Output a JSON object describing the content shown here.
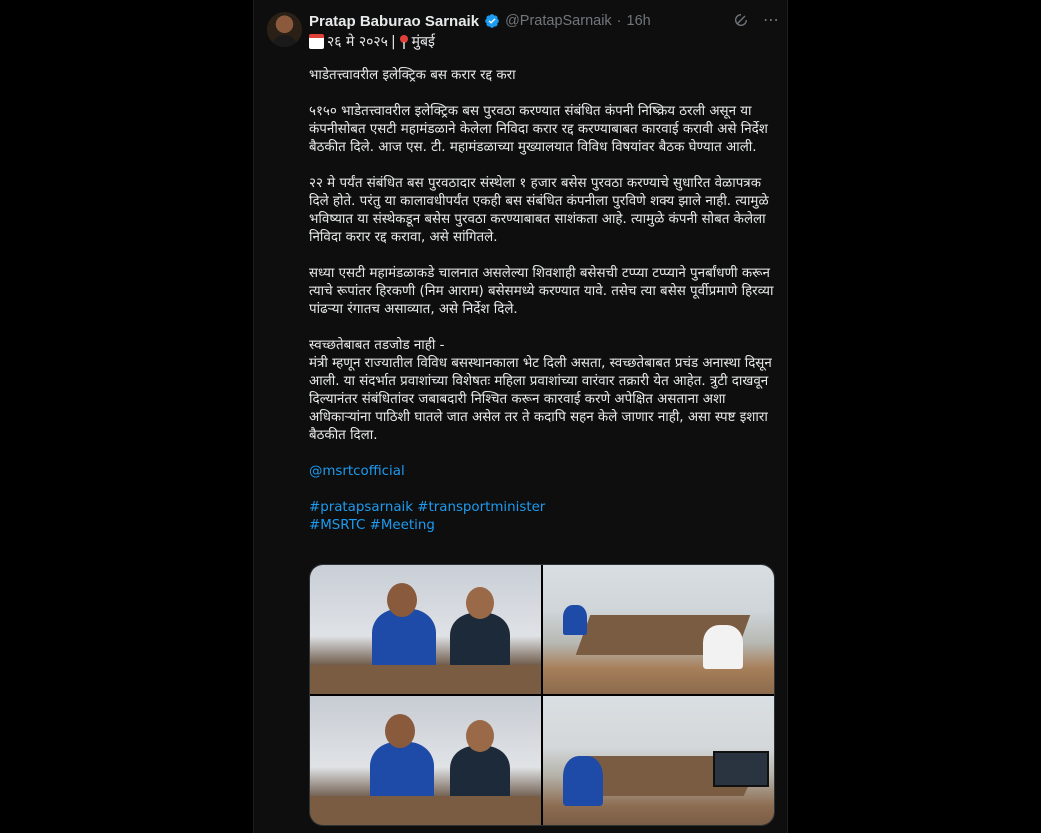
{
  "author": {
    "display_name": "Pratap Baburao Sarnaik",
    "handle": "@PratapSarnaik",
    "separator": "·",
    "time": "16h"
  },
  "header_icons": {
    "grok": "grok-icon",
    "more": "more-icon"
  },
  "date_line": {
    "date": "२६ मे २०२५",
    "separator": "|",
    "place": "मुंबई"
  },
  "paragraphs": [
    "भाडेतत्त्वावरील इलेक्ट्रिक बस करार रद्द करा",
    "५१५० भाडेतत्त्वावरील इलेक्ट्रिक बस पुरवठा करण्यात संबंधित कंपनी निष्क्रिय ठरली असून या कंपनीसोबत एसटी महामंडळाने केलेला निविदा करार रद्द करण्याबाबत कारवाई करावी असे निर्देश बैठकीत दिले. आज एस. टी. महामंडळाच्या मुख्यालयात विविध विषयांवर बैठक घेण्यात आली.",
    "२२ मे पर्यंत संबंधित बस पुरवठादार संस्थेला १ हजार बसेस पुरवठा करण्याचे सुधारित वेळापत्रक दिले होते. परंतु या कालावधीपर्यंत एकही बस संबंधित कंपनीला पुरविणे शक्य झाले नाही. त्यामुळे भविष्यात या संस्थेकडून बसेस पुरवठा करण्याबाबत साशंकता आहे. त्यामुळे कंपनी सोबत केलेला निविदा करार रद्द करावा, असे सांगितले.",
    "सध्या एसटी महामंडळाकडे चालनात असलेल्या शिवशाही बसेसची टप्प्या टप्प्याने पुनर्बांधणी करून त्याचे रूपांतर हिरकणी (निम आराम) बसेसमध्ये करण्यात यावे. तसेच त्या बसेस पूर्वीप्रमाणे हिरव्या पांढऱ्या रंगातच असाव्यात, असे निर्देश दिले.",
    "स्वच्छतेबाबत तडजोड नाही -\nमंत्री म्हणून राज्यातील विविध बसस्थानकाला भेट दिली असता, स्वच्छतेबाबत प्रचंड अनास्था दिसून आली. या संदर्भात प्रवाशांच्या विशेषतः महिला प्रवाशांच्या वारंवार तक्रारी येत आहेत. त्रुटी दाखवून दिल्यानंतर संबंधितांवर जबाबदारी निश्चित करून कारवाई करणे अपेक्षित असताना अशा अधिकाऱ्यांना पाठिशी घातले जात असेल तर ते कदापि सहन केले जाणार नाही, असा स्पष्ट इशारा बैठकीत दिला."
  ],
  "mention": "@msrtcofficial",
  "hashtags_line1": [
    "#pratapsarnaik",
    "#transportminister"
  ],
  "hashtags_line2": [
    "#MSRTC",
    "#Meeting"
  ],
  "colors": {
    "link": "#1d9bf0",
    "verified": "#1d9bf0",
    "muted": "#71767b",
    "text": "#e7e9ea"
  }
}
